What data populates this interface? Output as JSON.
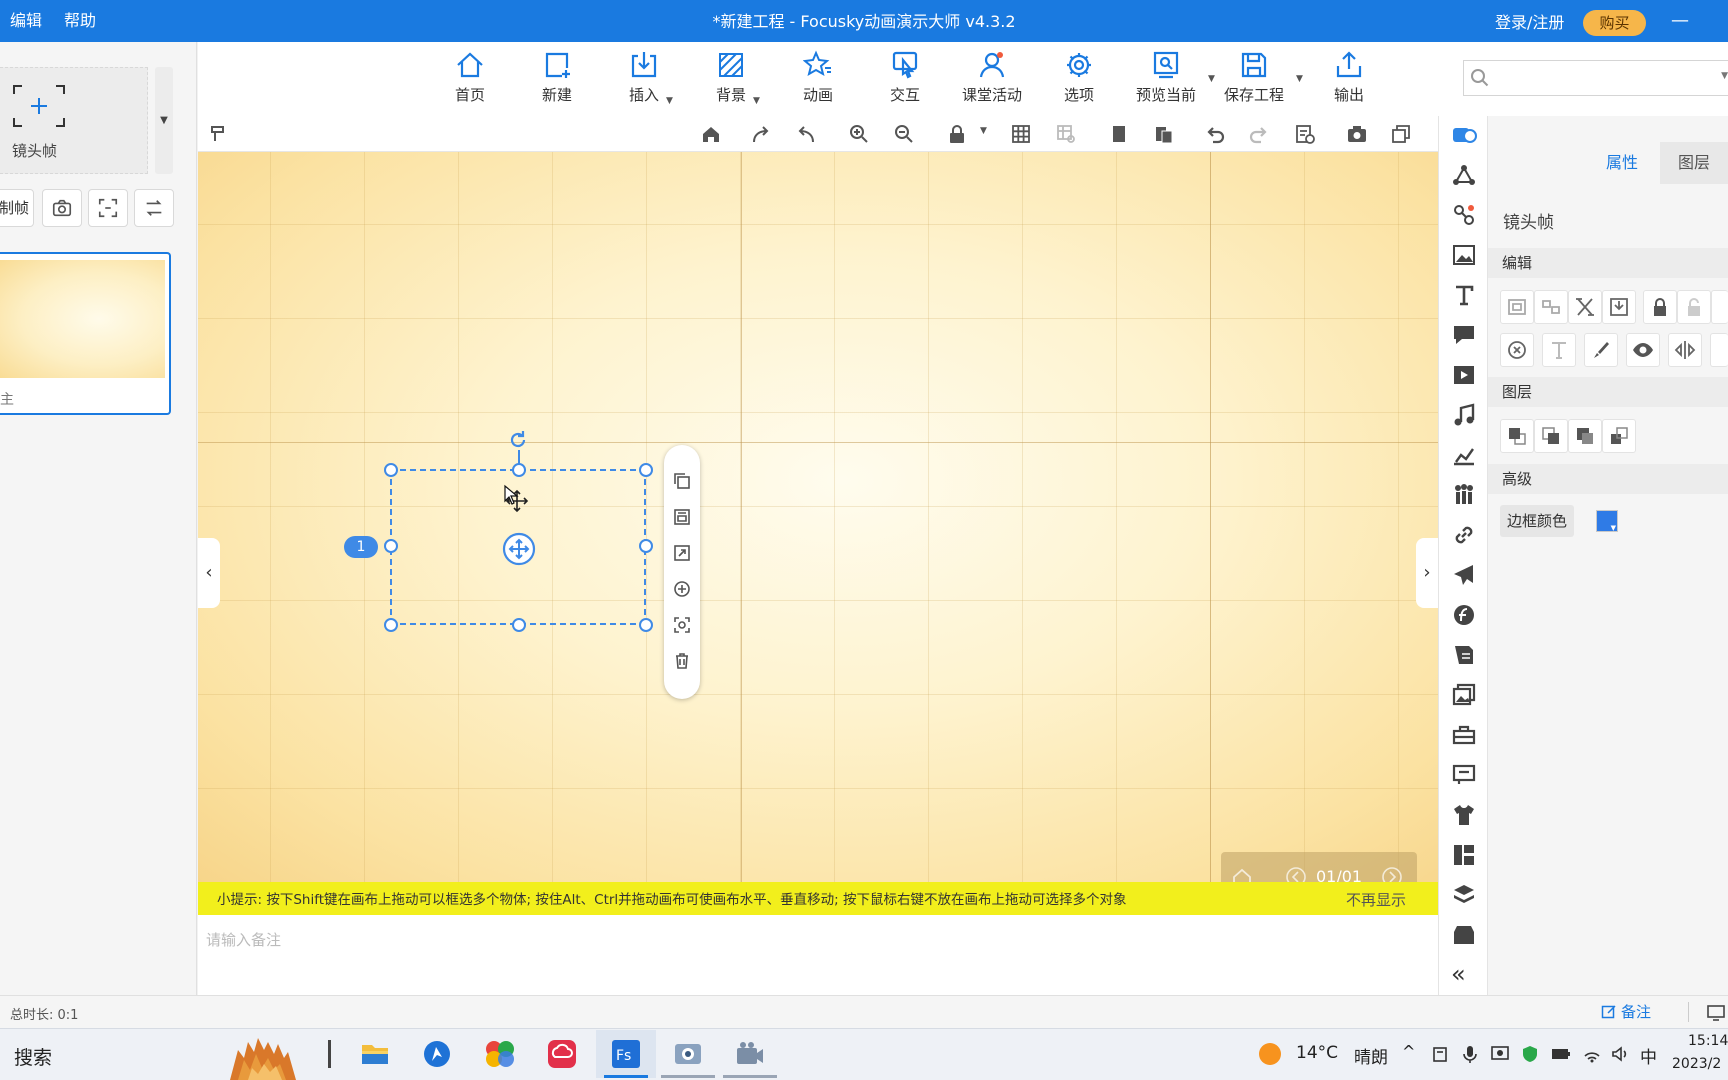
{
  "titlebar": {
    "menu_edit": "编辑",
    "menu_help": "帮助",
    "title": "*新建工程 - Focusky动画演示大师  v4.3.2",
    "login": "登录/注册",
    "buy": "购买",
    "minimize": "—"
  },
  "ribbon": {
    "home": "首页",
    "new": "新建",
    "insert": "插入",
    "background": "背景",
    "animation": "动画",
    "interact": "交互",
    "classroom": "课堂活动",
    "options": "选项",
    "preview": "预览当前",
    "save": "保存工程",
    "export": "输出"
  },
  "left_panel": {
    "add_frame_label": "镜头帧",
    "copy_frame_partial": "制帧",
    "slide_label_partial": "主"
  },
  "canvas": {
    "frame_number": "1",
    "nav_page": "01/01"
  },
  "tip": {
    "text": "小提示: 按下Shift键在画布上拖动可以框选多个物体; 按住Alt、Ctrl并拖动画布可使画布水平、垂直移动; 按下鼠标右键不放在画布上拖动可选择多个对象",
    "dismiss": "不再显示"
  },
  "notes": {
    "placeholder": "请输入备注"
  },
  "properties": {
    "tab_attr": "属性",
    "tab_layer": "图层",
    "object_name": "镜头帧",
    "section_edit": "编辑",
    "section_layer": "图层",
    "section_advanced": "高级",
    "border_color_label": "边框颜色",
    "border_color": "#2f7be6"
  },
  "status": {
    "duration": "总时长: 0:1",
    "notes_btn": "备注"
  },
  "taskbar": {
    "search": "搜索",
    "temperature": "14°C",
    "weather": "晴朗",
    "ime": "中",
    "time": "15:14",
    "date": "2023/2"
  },
  "colors": {
    "accent": "#1a7ae0",
    "tip_bg": "#f2ef1c",
    "buy_bg": "#f6b64a"
  }
}
